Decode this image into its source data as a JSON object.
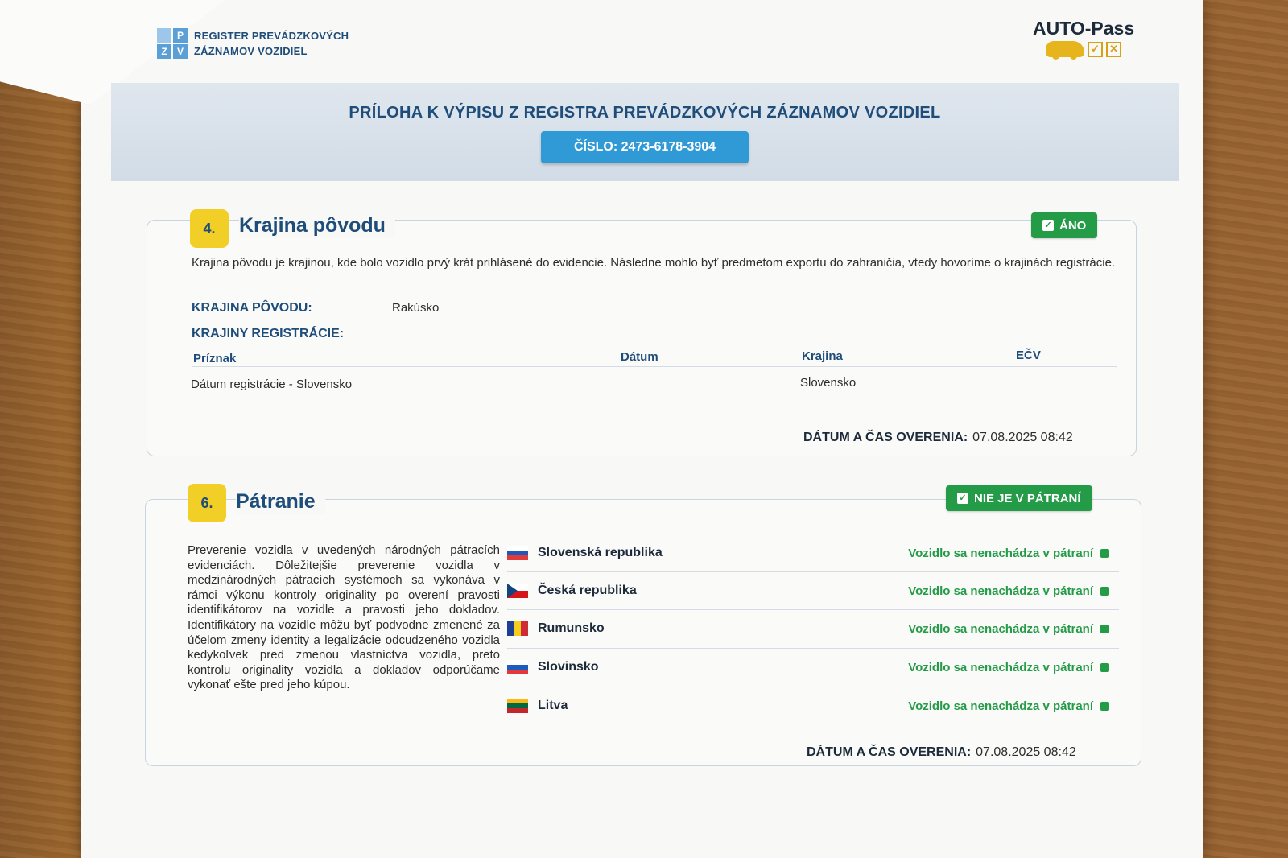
{
  "header": {
    "logo_letters": [
      "P",
      "Z",
      "V"
    ],
    "logo_line1": "REGISTER PREVÁDZKOVÝCH",
    "logo_line2": "ZÁZNAMOV VOZIDIEL",
    "autopass_title": "AUTO-Pass"
  },
  "banner": {
    "title": "PRÍLOHA K VÝPISU Z REGISTRA PREVÁDZKOVÝCH ZÁZNAMOV VOZIDIEL",
    "number": "ČÍSLO: 2473-6178-3904"
  },
  "section4": {
    "num": "4.",
    "title": "Krajina pôvodu",
    "badge": "ÁNO",
    "description": "Krajina pôvodu je krajinou, kde bolo vozidlo prvý krát prihlásené do evidencie. Následne mohlo byť predmetom exportu do zahraničia, vtedy hovoríme o krajinách registrácie.",
    "origin_label": "KRAJINA PÔVODU:",
    "origin_value": "Rakúsko",
    "reg_label": "KRAJINY REGISTRÁCIE:",
    "table_headers": [
      "Príznak",
      "Dátum",
      "Krajina",
      "EČV"
    ],
    "table_rows": [
      [
        "Dátum registrácie - Slovensko",
        "",
        "Slovensko",
        ""
      ]
    ],
    "verify_label": "DÁTUM A ČAS OVERENIA:",
    "verify_value": "07.08.2025 08:42"
  },
  "section6": {
    "num": "6.",
    "title": "Pátranie",
    "badge": "NIE JE V PÁTRANÍ",
    "description": "Preverenie vozidla v uvedených národných pátracích evidenciách. Dôležitejšie preverenie vozidla v medzinárodných pátracích systémoch sa vykonáva v rámci výkonu kontroly originality po overení pravosti identifikátorov na vozidle a pravosti jeho dokladov. Identifikátory na vozidle môžu byť podvodne zmenené za účelom zmeny identity a legalizácie odcudzeného vozidla kedykoľvek pred zmenou vlastníctva vozidla, preto kontrolu originality vozidla a dokladov odporúčame vykonať ešte pred jeho kúpou.",
    "countries": [
      {
        "name": "Slovenská republika",
        "status": "Vozidlo sa nenachádza v pátraní",
        "flag": "sk"
      },
      {
        "name": "Česká republika",
        "status": "Vozidlo sa nenachádza v pátraní",
        "flag": "cz"
      },
      {
        "name": "Rumunsko",
        "status": "Vozidlo sa nenachádza v pátraní",
        "flag": "ro"
      },
      {
        "name": "Slovinsko",
        "status": "Vozidlo sa nenachádza v pátraní",
        "flag": "si"
      },
      {
        "name": "Litva",
        "status": "Vozidlo sa nenachádza v pátraní",
        "flag": "lt"
      }
    ],
    "verify_label": "DÁTUM A ČAS OVERENIA:",
    "verify_value": "07.08.2025 08:42"
  },
  "colors": {
    "primary_blue": "#1f4d7a",
    "accent_blue": "#2f9ad6",
    "badge_green": "#239b47",
    "section_yellow": "#f2cf27"
  }
}
